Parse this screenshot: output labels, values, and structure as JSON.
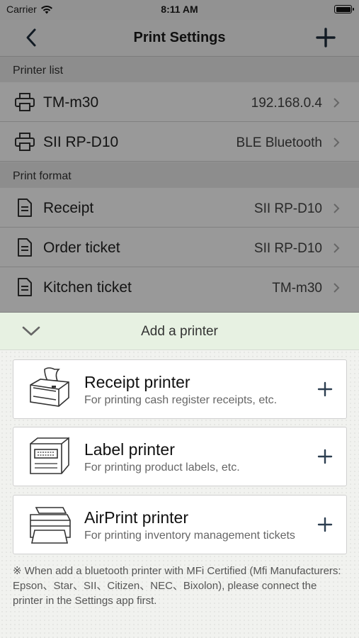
{
  "status": {
    "carrier": "Carrier",
    "time": "8:11 AM"
  },
  "nav": {
    "title": "Print Settings",
    "back_icon": "chevron-left-icon",
    "add_icon": "plus-icon"
  },
  "printer_list": {
    "header": "Printer list",
    "items": [
      {
        "label": "TM-m30",
        "value": "192.168.0.4",
        "icon": "printer-icon"
      },
      {
        "label": "SII RP-D10",
        "value": "BLE Bluetooth",
        "icon": "printer-icon"
      }
    ]
  },
  "print_format": {
    "header": "Print format",
    "items": [
      {
        "label": "Receipt",
        "value": "SII RP-D10",
        "icon": "document-icon"
      },
      {
        "label": "Order ticket",
        "value": "SII RP-D10",
        "icon": "document-icon"
      },
      {
        "label": "Kitchen ticket",
        "value": "TM-m30",
        "icon": "document-icon"
      }
    ]
  },
  "sheet": {
    "title": "Add a printer",
    "cards": [
      {
        "title": "Receipt printer",
        "subtitle": "For printing cash register receipts, etc.",
        "icon": "receipt-printer-icon"
      },
      {
        "title": "Label printer",
        "subtitle": "For printing product labels, etc.",
        "icon": "label-printer-icon"
      },
      {
        "title": "AirPrint printer",
        "subtitle": "For printing inventory management tickets",
        "icon": "airprint-printer-icon"
      }
    ],
    "footnote": "※ When add a bluetooth printer with MFi Certified (Mfi Manufacturers: Epson、Star、SII、Citizen、NEC、Bixolon), please connect the printer in the Settings app first."
  },
  "colors": {
    "sheet_header_bg": "#e7f1e2",
    "overlay": "rgba(0,0,0,0.40)",
    "accent": "#2c3e50"
  }
}
